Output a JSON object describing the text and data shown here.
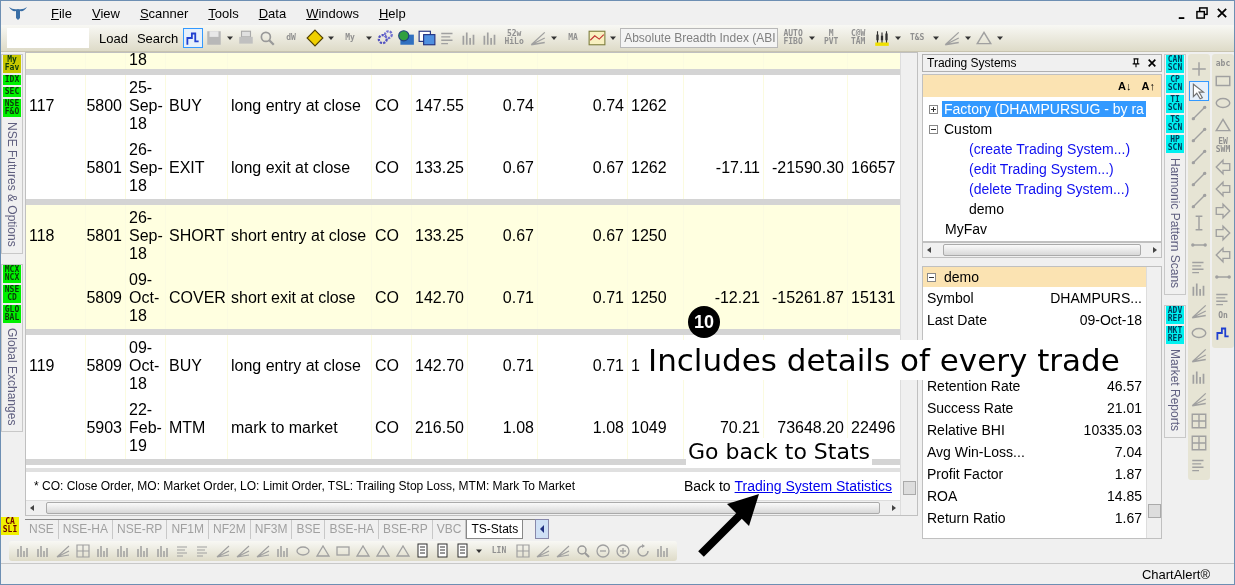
{
  "menu": {
    "items": [
      {
        "label": "File"
      },
      {
        "label": "View"
      },
      {
        "label": "Scanner"
      },
      {
        "label": "Tools"
      },
      {
        "label": "Data"
      },
      {
        "label": "Windows"
      },
      {
        "label": "Help"
      }
    ]
  },
  "toolbar": {
    "items": [
      {
        "kind": "field"
      },
      {
        "kind": "button",
        "label": "Load"
      },
      {
        "kind": "button",
        "label": "Search"
      },
      {
        "kind": "icon",
        "selected": true
      },
      {
        "kind": "icon",
        "selected": false
      },
      {
        "kind": "caret"
      },
      {
        "kind": "icon",
        "selected": false
      },
      {
        "kind": "icon",
        "selected": false
      },
      {
        "kind": "tiny",
        "label": "dW"
      },
      {
        "kind": "icon",
        "selected": false
      },
      {
        "kind": "caret"
      },
      {
        "kind": "tiny",
        "label": "My"
      },
      {
        "kind": "caret"
      },
      {
        "kind": "icon",
        "selected": false
      },
      {
        "kind": "icon",
        "selected": false
      },
      {
        "kind": "icon",
        "selected": false
      },
      {
        "kind": "icon",
        "selected": false
      },
      {
        "kind": "icon",
        "selected": false
      },
      {
        "kind": "icon",
        "selected": false
      },
      {
        "kind": "tiny",
        "label": "52w HiLo"
      },
      {
        "kind": "icon",
        "selected": false
      },
      {
        "kind": "caret"
      },
      {
        "kind": "tiny",
        "label": "MA"
      },
      {
        "kind": "icon",
        "selected": false
      },
      {
        "kind": "caret"
      },
      {
        "kind": "dropdown",
        "value": "Absolute Breadth Index (ABI"
      },
      {
        "kind": "tiny",
        "label": "AUTO FIBO"
      },
      {
        "kind": "caret"
      },
      {
        "kind": "tiny",
        "label": "M PVT"
      },
      {
        "kind": "tiny",
        "label": "C@W TAM"
      },
      {
        "kind": "icon",
        "selected": false
      },
      {
        "kind": "caret"
      },
      {
        "kind": "tiny",
        "label": "T&S"
      },
      {
        "kind": "caret"
      },
      {
        "kind": "icon",
        "selected": false
      },
      {
        "kind": "caret"
      },
      {
        "kind": "icon",
        "selected": false
      },
      {
        "kind": "caret"
      }
    ]
  },
  "left_sidebar": {
    "groups": [
      {
        "badges": [
          {
            "label": "My Fav",
            "color": "#c8c800"
          },
          {
            "label": "IDX",
            "color": "#00f000"
          },
          {
            "label": "SEC",
            "color": "#00f000"
          },
          {
            "label": "NSE F&O",
            "color": "#00f000"
          }
        ],
        "title": "NSE Futures & Options"
      },
      {
        "badges": [
          {
            "label": "MCX NCX",
            "color": "#00f000"
          },
          {
            "label": "NSE CD",
            "color": "#00f000"
          },
          {
            "label": "GLO BAL",
            "color": "#00f000"
          }
        ],
        "title": "Global Exchanges"
      }
    ],
    "bottom_badge": {
      "label": "CA SLI",
      "color": "#f0f000"
    }
  },
  "trades": [
    {
      "rows": [
        {
          "column_3": "18"
        }
      ]
    },
    {
      "rows": [
        {
          "column_1": "117",
          "column_2": "5800",
          "column_3": "25-Sep-18",
          "column_4": "BUY",
          "column_5": "long entry at close",
          "column_6": "CO",
          "column_7": "147.55",
          "column_8": "0.74",
          "column_9": "0.74",
          "column_10": "1262"
        },
        {
          "column_2": "5801",
          "column_3": "26-Sep-18",
          "column_4": "EXIT",
          "column_5": "long exit at close",
          "column_6": "CO",
          "column_7": "133.25",
          "column_8": "0.67",
          "column_9": "0.67",
          "column_10": "1262",
          "column_11": "-17.11",
          "column_12": "-21590.30",
          "column_13": "16657"
        }
      ]
    },
    {
      "rows": [
        {
          "column_1": "118",
          "column_2": "5801",
          "column_3": "26-Sep-18",
          "column_4": "SHORT",
          "column_5": "short entry at close",
          "column_6": "CO",
          "column_7": "133.25",
          "column_8": "0.67",
          "column_9": "0.67",
          "column_10": "1250"
        },
        {
          "column_2": "5809",
          "column_3": "09-Oct-18",
          "column_4": "COVER",
          "column_5": "short exit at close",
          "column_6": "CO",
          "column_7": "142.70",
          "column_8": "0.71",
          "column_9": "0.71",
          "column_10": "1250",
          "column_11": "-12.21",
          "column_12": "-15261.87",
          "column_13": "15131"
        }
      ]
    },
    {
      "rows": [
        {
          "column_1": "119",
          "column_2": "5809",
          "column_3": "09-Oct-18",
          "column_4": "BUY",
          "column_5": "long entry at close",
          "column_6": "CO",
          "column_7": "142.70",
          "column_8": "0.71",
          "column_9": "0.71",
          "column_10": "1"
        },
        {
          "column_2": "5903",
          "column_3": "22-Feb-19",
          "column_4": "MTM",
          "column_5": "mark to market",
          "column_6": "CO",
          "column_7": "216.50",
          "column_8": "1.08",
          "column_9": "1.08",
          "column_10": "1049",
          "column_11": "70.21",
          "column_12": "73648.20",
          "column_13": "22496"
        }
      ]
    }
  ],
  "footnote": "* CO: Close Order, MO: Market Order, LO: Limit Order, TSL: Trailing Stop Loss, MTM: Mark To Market",
  "back_link": {
    "prefix": "Back to",
    "link": "Trading System Statistics"
  },
  "sheet_tabs": [
    {
      "label": "NSE",
      "selected": false
    },
    {
      "label": "NSE-HA",
      "selected": false
    },
    {
      "label": "NSE-RP",
      "selected": false
    },
    {
      "label": "NF1M",
      "selected": false
    },
    {
      "label": "NF2M",
      "selected": false
    },
    {
      "label": "NF3M",
      "selected": false
    },
    {
      "label": "BSE",
      "selected": false
    },
    {
      "label": "BSE-HA",
      "selected": false
    },
    {
      "label": "BSE-RP",
      "selected": false
    },
    {
      "label": "VBC",
      "selected": false
    },
    {
      "label": "TS-Stats",
      "selected": true
    }
  ],
  "trading_systems": {
    "title": "Trading Systems",
    "sort_buttons": [
      "A↓",
      "A↑"
    ],
    "tree": [
      {
        "label": "Factory (DHAMPURSUG - by ra",
        "kind": "node",
        "expanded": false,
        "selected": true
      },
      {
        "label": "Custom",
        "kind": "node",
        "expanded": true,
        "selected": false,
        "children": [
          {
            "label": "(create Trading System...)",
            "kind": "action",
            "selected": false
          },
          {
            "label": "(edit Trading System...)",
            "kind": "action",
            "selected": false
          },
          {
            "label": "(delete Trading System...)",
            "kind": "action",
            "selected": false
          },
          {
            "label": "demo",
            "kind": "node",
            "selected": false
          }
        ]
      },
      {
        "label": "MyFav",
        "kind": "node",
        "selected": false
      }
    ],
    "properties": {
      "category": "demo",
      "expanded": true,
      "rows": [
        {
          "name": "Symbol",
          "value": "DHAMPURS..."
        },
        {
          "name": "Last Date",
          "value": "09-Oct-18"
        },
        {
          "name": "Retention Rate",
          "value": "46.57"
        },
        {
          "name": "Success Rate",
          "value": "21.01"
        },
        {
          "name": "Relative BHI",
          "value": "10335.03"
        },
        {
          "name": "Avg Win-Loss...",
          "value": "7.04"
        },
        {
          "name": "Profit Factor",
          "value": "1.87"
        },
        {
          "name": "ROA",
          "value": "14.85"
        },
        {
          "name": "Return Ratio",
          "value": "1.67"
        }
      ]
    }
  },
  "right_sidebar": {
    "groups": [
      {
        "badges": [
          {
            "label": "CAN SCN",
            "color": "#00f0f0"
          },
          {
            "label": "CP SCN",
            "color": "#00f0f0"
          },
          {
            "label": "TI SCN",
            "color": "#00f0f0"
          },
          {
            "label": "TS SCN",
            "color": "#00f0f0"
          },
          {
            "label": "HP SCN",
            "color": "#00f0f0"
          }
        ],
        "title": "Harmonic Pattern Scans"
      },
      {
        "badges": [
          {
            "label": "ADV REP",
            "color": "#00f0f0"
          },
          {
            "label": "MKT REP",
            "color": "#00f0f0"
          }
        ],
        "title": "Market Reports"
      }
    ]
  },
  "drawing_tools": [
    {
      "items": [
        {
          "kind": "icon",
          "selected": false
        },
        {
          "kind": "icon",
          "selected": true
        },
        {
          "kind": "icon",
          "selected": false
        },
        {
          "kind": "icon",
          "selected": false
        },
        {
          "kind": "icon",
          "selected": false
        },
        {
          "kind": "icon",
          "selected": false
        },
        {
          "kind": "icon",
          "selected": false
        },
        {
          "kind": "icon",
          "selected": false
        },
        {
          "kind": "icon",
          "selected": false
        },
        {
          "kind": "icon",
          "selected": false
        },
        {
          "kind": "icon",
          "selected": false
        },
        {
          "kind": "icon",
          "selected": false
        },
        {
          "kind": "icon",
          "selected": false
        },
        {
          "kind": "icon",
          "selected": false
        },
        {
          "kind": "icon",
          "selected": false
        },
        {
          "kind": "icon",
          "selected": false
        },
        {
          "kind": "icon",
          "selected": false
        },
        {
          "kind": "icon",
          "selected": false
        },
        {
          "kind": "icon",
          "selected": false
        }
      ]
    },
    {
      "items": [
        {
          "kind": "tiny",
          "label": "abc"
        },
        {
          "kind": "icon",
          "selected": false
        },
        {
          "kind": "icon",
          "selected": false
        },
        {
          "kind": "icon",
          "selected": false
        },
        {
          "kind": "tiny",
          "label": "EW SWM"
        },
        {
          "kind": "icon",
          "selected": false
        },
        {
          "kind": "icon",
          "selected": false
        },
        {
          "kind": "icon",
          "selected": false
        },
        {
          "kind": "icon",
          "selected": false
        },
        {
          "kind": "icon",
          "selected": false
        },
        {
          "kind": "icon",
          "selected": false
        },
        {
          "kind": "icon",
          "selected": false
        },
        {
          "kind": "tiny",
          "label": "On"
        },
        {
          "kind": "icon",
          "selected": false
        }
      ]
    }
  ],
  "bottom_toolbar": {
    "items": [
      {
        "kind": "icon",
        "selected": false
      },
      {
        "kind": "icon",
        "selected": false
      },
      {
        "kind": "icon",
        "selected": false
      },
      {
        "kind": "icon",
        "selected": false
      },
      {
        "kind": "icon",
        "selected": false
      },
      {
        "kind": "icon",
        "selected": false
      },
      {
        "kind": "icon",
        "selected": false
      },
      {
        "kind": "icon",
        "selected": false
      },
      {
        "kind": "icon",
        "selected": false
      },
      {
        "kind": "icon",
        "selected": false
      },
      {
        "kind": "icon",
        "selected": false
      },
      {
        "kind": "icon",
        "selected": false
      },
      {
        "kind": "icon",
        "selected": false
      },
      {
        "kind": "icon",
        "selected": false
      },
      {
        "kind": "icon",
        "selected": false
      },
      {
        "kind": "icon",
        "selected": false
      },
      {
        "kind": "icon",
        "selected": false
      },
      {
        "kind": "icon",
        "selected": false
      },
      {
        "kind": "icon",
        "selected": false
      },
      {
        "kind": "icon",
        "selected": false
      },
      {
        "kind": "icon",
        "selected": false
      },
      {
        "kind": "icon",
        "selected": false
      },
      {
        "kind": "icon",
        "selected": false
      },
      {
        "kind": "caret"
      },
      {
        "kind": "tiny",
        "label": "LIN"
      },
      {
        "kind": "icon",
        "selected": false
      },
      {
        "kind": "icon",
        "selected": false
      },
      {
        "kind": "icon",
        "selected": false
      },
      {
        "kind": "icon",
        "selected": false
      },
      {
        "kind": "icon",
        "selected": false
      },
      {
        "kind": "icon",
        "selected": false
      },
      {
        "kind": "icon",
        "selected": false
      },
      {
        "kind": "icon",
        "selected": false
      }
    ]
  },
  "status_bar": {
    "text": "ChartAlert®"
  },
  "annotations": [
    {
      "kind": "badge",
      "text": "10"
    },
    {
      "kind": "caption",
      "text": "Includes details of every trade"
    },
    {
      "kind": "caption",
      "text": "Go back to Stats"
    },
    {
      "kind": "arrow"
    }
  ]
}
